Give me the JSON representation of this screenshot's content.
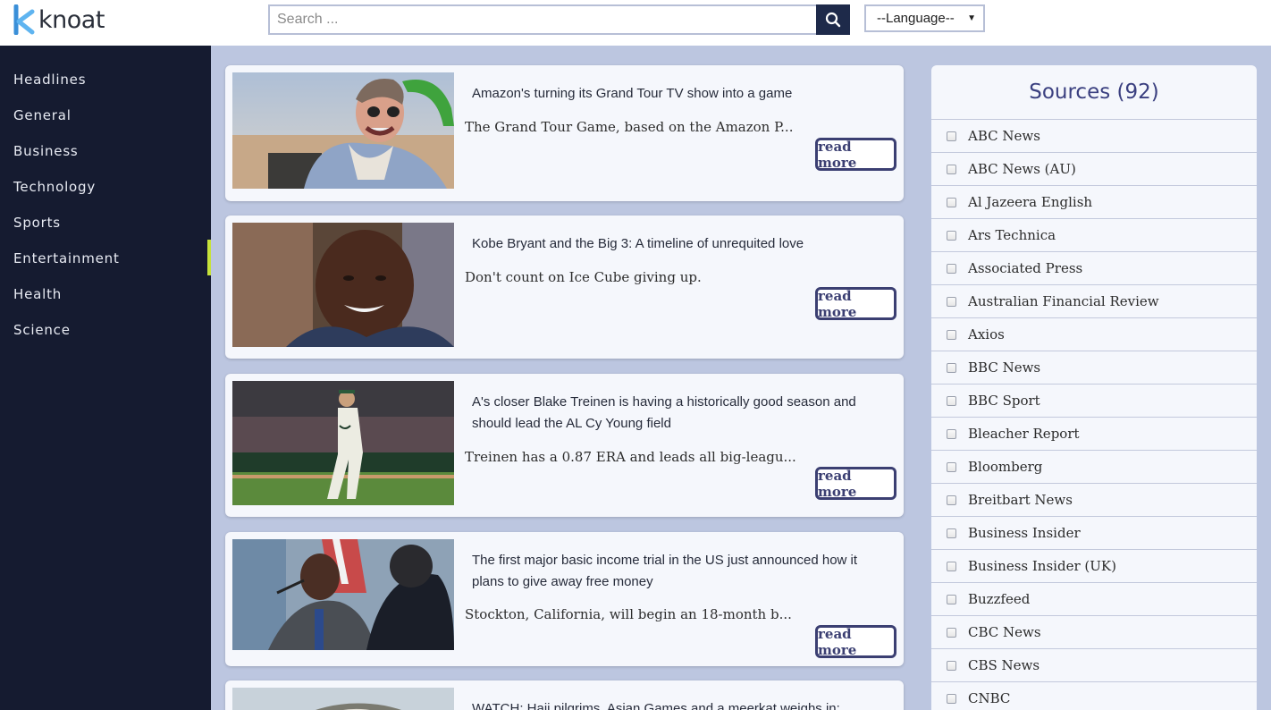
{
  "header": {
    "logo_text": "knoat",
    "search_placeholder": "Search ...",
    "language_label": "--Language--"
  },
  "sidebar": {
    "items": [
      {
        "label": "Headlines"
      },
      {
        "label": "General"
      },
      {
        "label": "Business"
      },
      {
        "label": "Technology"
      },
      {
        "label": "Sports"
      },
      {
        "label": "Entertainment",
        "active": true
      },
      {
        "label": "Health"
      },
      {
        "label": "Science"
      }
    ]
  },
  "articles": [
    {
      "title": "Amazon's turning its Grand Tour TV show into a game",
      "description": "The Grand Tour Game, based on the Amazon P...",
      "read_more": "read more"
    },
    {
      "title": "Kobe Bryant and the Big 3: A timeline of unrequited love",
      "description": "Don't count on Ice Cube giving up.",
      "read_more": "read more"
    },
    {
      "title": "A's closer Blake Treinen is having a historically good season and should lead the AL Cy Young field",
      "description": "Treinen has a 0.87 ERA and leads all big-leagu...",
      "read_more": "read more"
    },
    {
      "title": "The first major basic income trial in the US just announced how it plans to give away free money",
      "description": "Stockton, California, will begin an 18-month b...",
      "read_more": "read more"
    },
    {
      "title": "WATCH: Hajj pilgrims, Asian Games and a meerkat weighs in:"
    }
  ],
  "sources": {
    "title": "Sources (92)",
    "items": [
      "ABC News",
      "ABC News (AU)",
      "Al Jazeera English",
      "Ars Technica",
      "Associated Press",
      "Australian Financial Review",
      "Axios",
      "BBC News",
      "BBC Sport",
      "Bleacher Report",
      "Bloomberg",
      "Breitbart News",
      "Business Insider",
      "Business Insider (UK)",
      "Buzzfeed",
      "CBC News",
      "CBS News",
      "CNBC"
    ]
  },
  "colors": {
    "sidebar_bg": "#151b30",
    "page_bg": "#bcc6e0",
    "active_marker": "#c6e23a",
    "accent": "#3b3f72"
  }
}
